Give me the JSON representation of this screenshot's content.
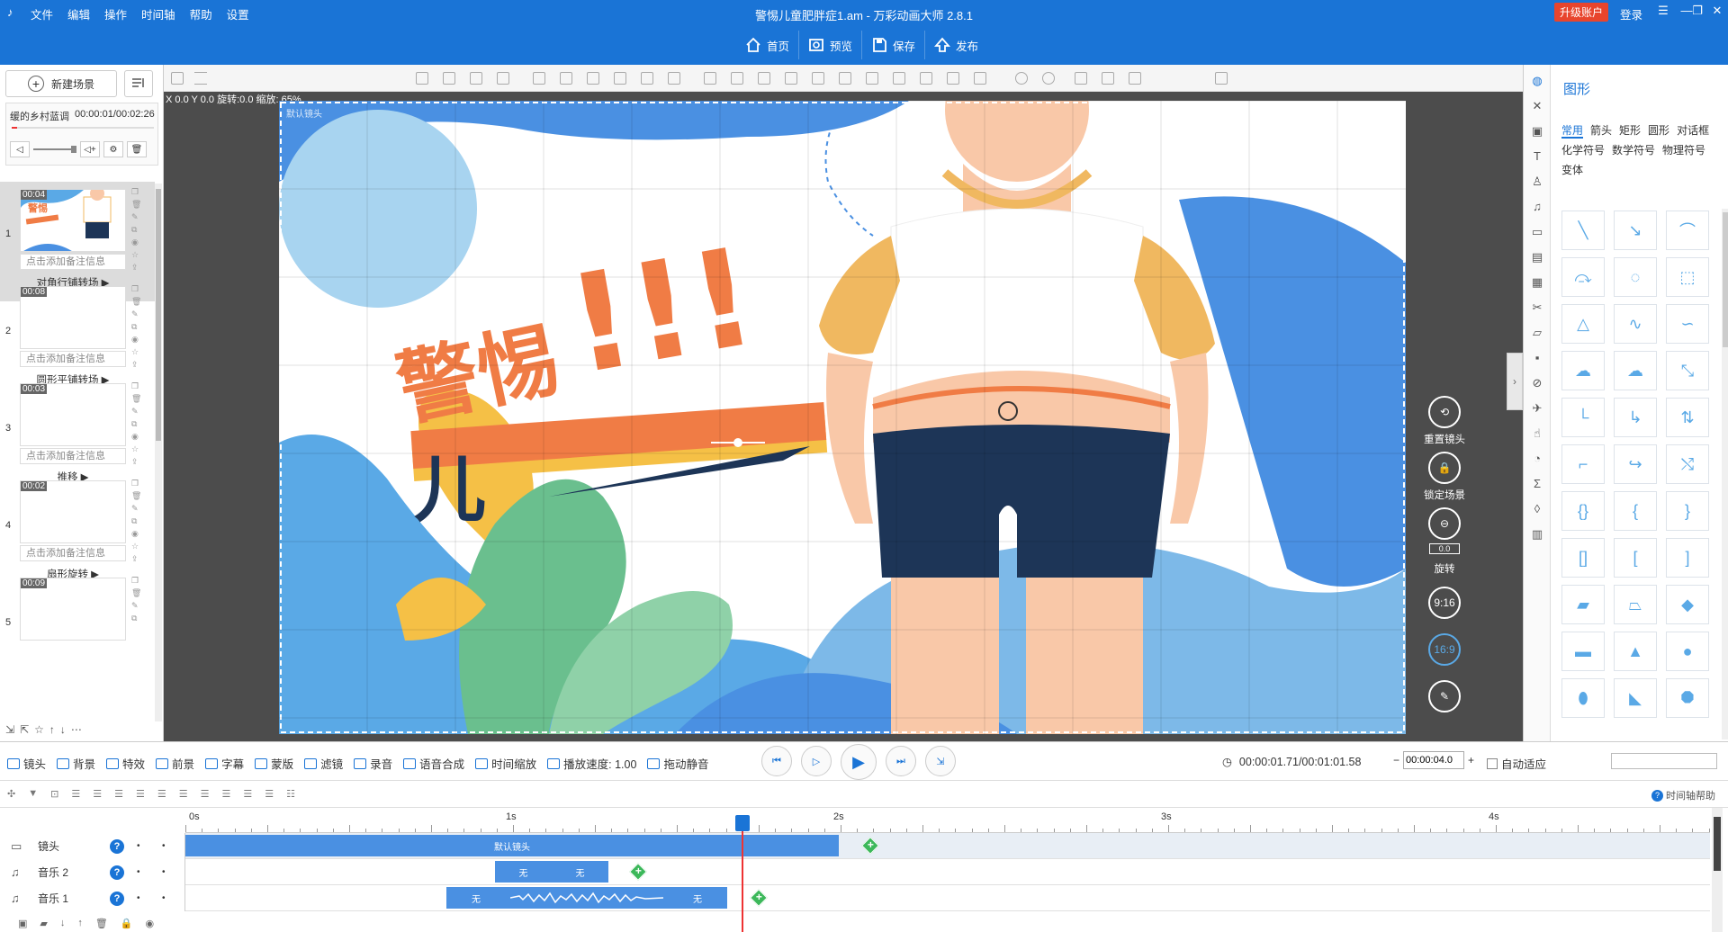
{
  "app": {
    "logo": "♪",
    "window_title": "警惕儿童肥胖症1.am - 万彩动画大师 2.8.1",
    "menu": [
      "文件",
      "编辑",
      "操作",
      "时间轴",
      "帮助",
      "设置"
    ],
    "upgrade": "升级账户",
    "login": "登录"
  },
  "top_actions": [
    {
      "label": "首页",
      "icon": "home-icon"
    },
    {
      "label": "预览",
      "icon": "preview-icon"
    },
    {
      "label": "保存",
      "icon": "save-icon"
    },
    {
      "label": "发布",
      "icon": "publish-icon"
    }
  ],
  "left_panel": {
    "new_scene": "新建场景",
    "music": {
      "name": "缓的乡村蓝调",
      "time": "00:00:01/00:02:26"
    },
    "scenes": [
      {
        "num": "1",
        "duration": "00:04",
        "note": "点击添加备注信息",
        "transition": "对角行铺转场",
        "selected": true
      },
      {
        "num": "2",
        "duration": "00:08",
        "note": "点击添加备注信息",
        "transition": "圆形平铺转场",
        "selected": false
      },
      {
        "num": "3",
        "duration": "00:03",
        "note": "点击添加备注信息",
        "transition": "推移",
        "selected": false
      },
      {
        "num": "4",
        "duration": "00:02",
        "note": "点击添加备注信息",
        "transition": "扇形旋转",
        "selected": false
      },
      {
        "num": "5",
        "duration": "00:09",
        "note": "",
        "transition": "",
        "selected": false
      }
    ]
  },
  "canvas": {
    "info": "X 0.0 Y 0.0 旋转:0.0 缩放: 65%",
    "camera_label": "默认镜头",
    "headline": "警惕",
    "exclaim": "!!!",
    "subtext": "儿"
  },
  "side_controls": {
    "reset_camera": "重置镜头",
    "lock_scene": "锁定场景",
    "rotate": "旋转",
    "rotate_value": "0.0",
    "ratio_916": "9:16",
    "ratio_169": "16:9"
  },
  "right_panel": {
    "title": "图形",
    "tabs": [
      "常用",
      "箭头",
      "矩形",
      "圆形",
      "对话框",
      "化学符号",
      "数学符号",
      "物理符号",
      "变体"
    ],
    "active_tab": "常用"
  },
  "timeline_toolbar": {
    "items": [
      "镜头",
      "背景",
      "特效",
      "前景",
      "字幕",
      "蒙版",
      "滤镜",
      "录音",
      "语音合成",
      "时间缩放",
      "播放速度: 1.00",
      "拖动静音"
    ],
    "time": "00:00:01.71/00:01:01.58",
    "zoom_value": "00:00:04.0",
    "auto_fit": "自动适应",
    "help": "时间轴帮助"
  },
  "timeline": {
    "ruler": [
      "0s",
      "1s",
      "2s",
      "3s",
      "4s"
    ],
    "tracks": [
      {
        "name": "镜头",
        "icon": "camera-icon",
        "clips": [
          {
            "label": "默认镜头"
          }
        ]
      },
      {
        "name": "音乐 2",
        "icon": "music-icon",
        "clips": [
          {
            "label": "无"
          },
          {
            "label": "无"
          }
        ]
      },
      {
        "name": "音乐 1",
        "icon": "music-icon",
        "clips": [
          {
            "label": "无"
          },
          {
            "label": "无"
          }
        ]
      }
    ]
  },
  "colors": {
    "accent": "#1a74d6",
    "orange": "#f07c45",
    "navy": "#1d3557",
    "sky": "#5aa9e6"
  }
}
